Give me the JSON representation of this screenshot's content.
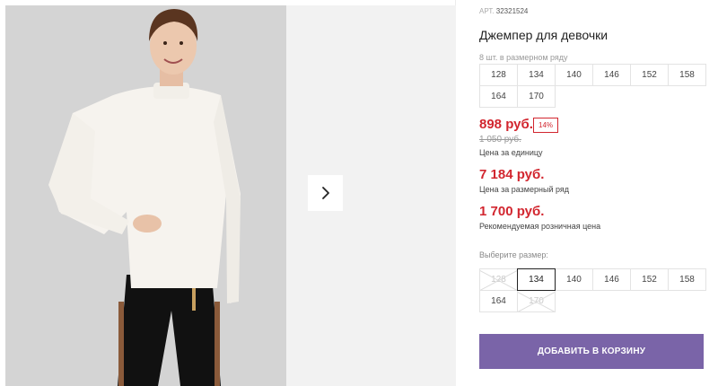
{
  "gallery": {
    "main_image": "product-photo-girl-white-sweater",
    "next_icon": "chevron-right-icon"
  },
  "product": {
    "article_label": "АРТ.",
    "article_value": "32321524",
    "title": "Джемпер для девочки",
    "row_count": "8 шт. в размерном ряду",
    "row_sizes": [
      "128",
      "134",
      "140",
      "146",
      "152",
      "158",
      "164",
      "170"
    ],
    "price": "898 руб.",
    "discount": "14%",
    "old_price": "1 050 руб.",
    "unit_caption": "Цена за единицу",
    "row_price": "7 184 руб.",
    "row_caption": "Цена за размерный ряд",
    "rrp_price": "1 700 руб.",
    "rrp_caption": "Рекомендуемая розничная цена",
    "choose_label": "Выберите размер:",
    "choose_sizes": [
      {
        "label": "128",
        "state": "disabled"
      },
      {
        "label": "134",
        "state": "selected"
      },
      {
        "label": "140",
        "state": "available"
      },
      {
        "label": "146",
        "state": "available"
      },
      {
        "label": "152",
        "state": "available"
      },
      {
        "label": "158",
        "state": "available"
      },
      {
        "label": "164",
        "state": "available"
      },
      {
        "label": "170",
        "state": "disabled"
      }
    ],
    "add_to_cart": "ДОБАВИТЬ В КОРЗИНУ"
  },
  "colors": {
    "price_red": "#d2262f",
    "button_purple": "#7a64a8"
  }
}
